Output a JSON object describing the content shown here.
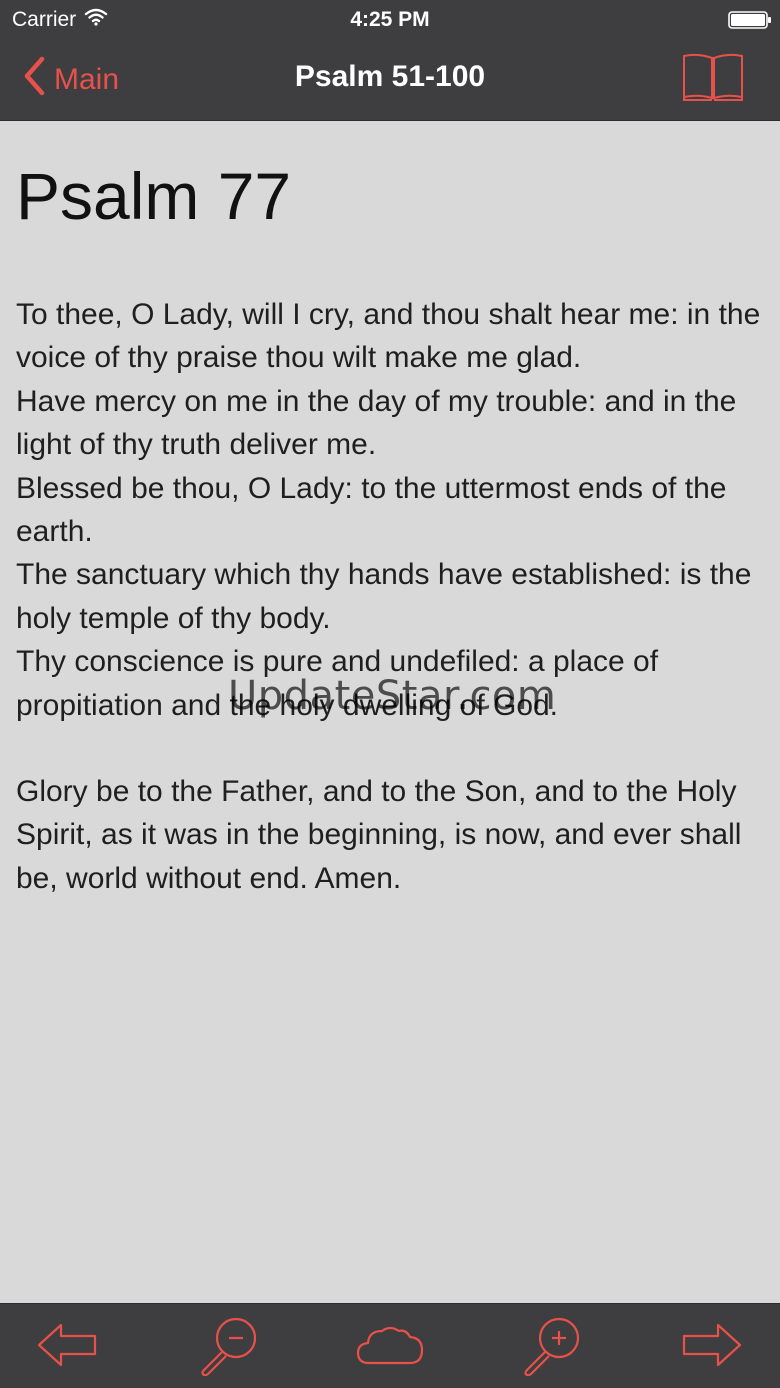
{
  "status_bar": {
    "carrier": "Carrier",
    "time": "4:25 PM",
    "wifi_icon": "wifi-icon",
    "battery_icon": "battery-icon"
  },
  "nav": {
    "back_label": "Main",
    "title": "Psalm 51-100",
    "book_icon": "book-icon"
  },
  "content": {
    "title": "Psalm 77",
    "verses": [
      "To thee, O Lady, will I cry, and thou shalt hear me: in the voice of thy praise thou wilt make me glad.",
      "Have mercy on me in the day of my trouble: and in the light of thy truth deliver me.",
      "Blessed be thou, O Lady: to the uttermost ends of the earth.",
      "The sanctuary which thy hands have established: is the holy temple of thy body.",
      "Thy conscience is pure and undefiled: a place of propitiation and the holy dwelling of God."
    ],
    "gloria": "Glory be to the Father, and to the Son, and to the Holy Spirit, as it was in the beginning, is now, and ever shall be, world without end. Amen."
  },
  "watermark": "UpdateStar.com",
  "toolbar": {
    "items": [
      "arrow-left-icon",
      "zoom-out-icon",
      "cloud-icon",
      "zoom-in-icon",
      "arrow-right-icon"
    ]
  },
  "colors": {
    "accent": "#e8514a",
    "bar_background": "#3e3e40",
    "page_background": "#d9d9d9"
  }
}
